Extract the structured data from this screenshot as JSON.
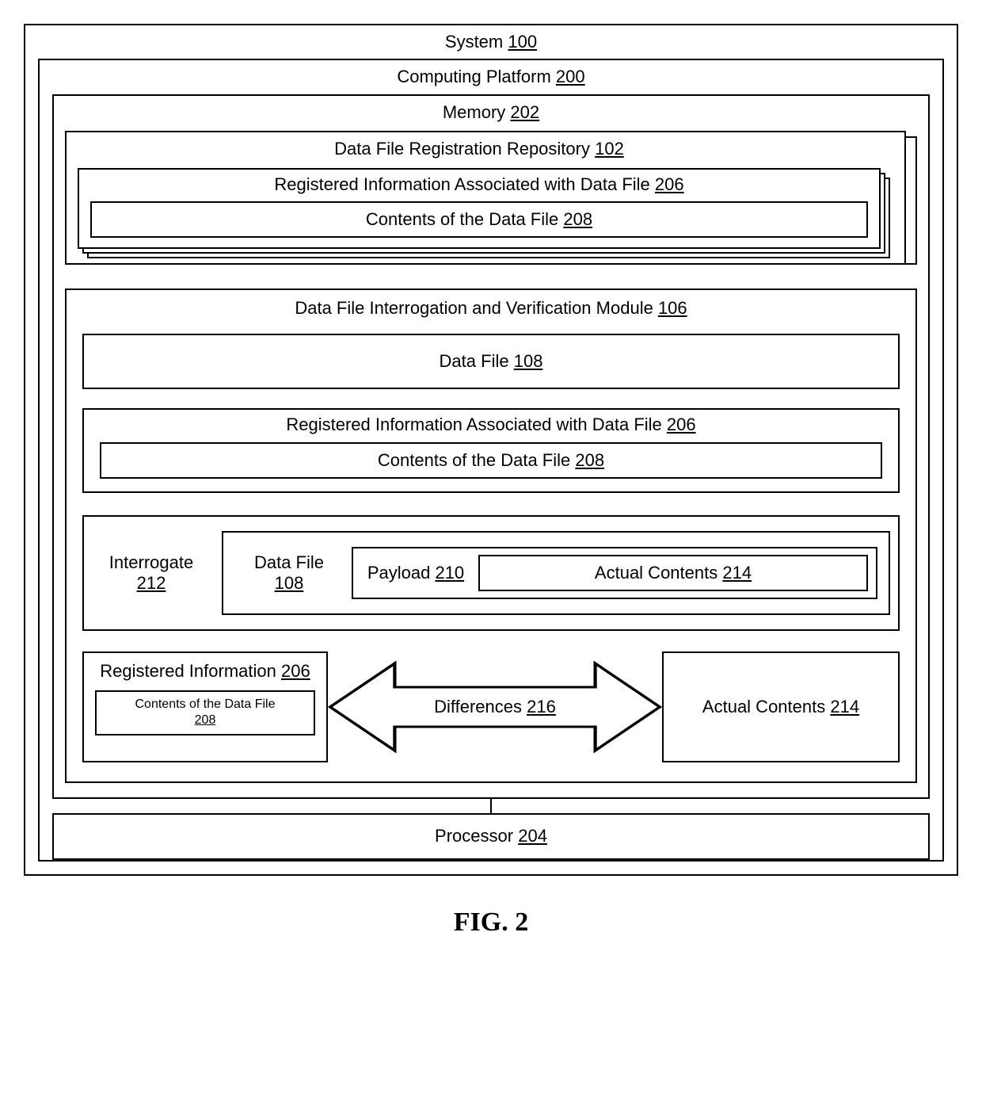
{
  "system": {
    "label": "System",
    "ref": "100"
  },
  "platform": {
    "label": "Computing Platform",
    "ref": "200"
  },
  "memory": {
    "label": "Memory",
    "ref": "202"
  },
  "repo": {
    "label": "Data File Registration Repository",
    "ref": "102"
  },
  "regInfo": {
    "label": "Registered Information Associated with Data File",
    "ref": "206"
  },
  "contents": {
    "label": "Contents of the Data File",
    "ref": "208"
  },
  "module": {
    "label": "Data File Interrogation and Verification Module",
    "ref": "106"
  },
  "dataFile": {
    "label": "Data File",
    "ref": "108"
  },
  "interrogate": {
    "label": "Interrogate",
    "ref": "212"
  },
  "payload": {
    "label": "Payload",
    "ref": "210"
  },
  "actualContents": {
    "label": "Actual Contents",
    "ref": "214"
  },
  "regInfoShort": {
    "label": "Registered Information",
    "ref": "206"
  },
  "contentsMultiline": {
    "label": "Contents of the Data File",
    "ref": "208"
  },
  "differences": {
    "label": "Differences",
    "ref": "216"
  },
  "processor": {
    "label": "Processor",
    "ref": "204"
  },
  "figure": "FIG. 2"
}
